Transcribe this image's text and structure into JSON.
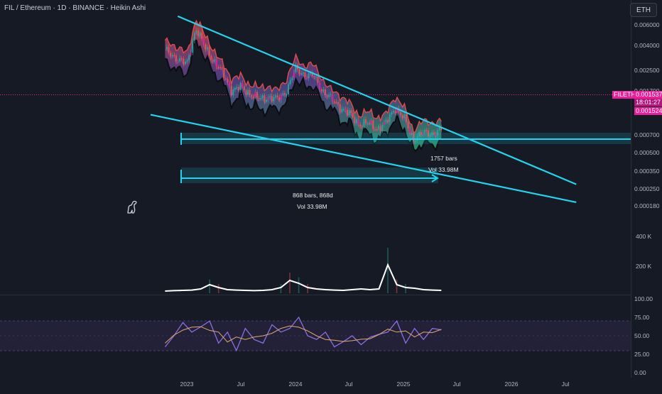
{
  "header": {
    "title": "FIL / Ethereum · 1D · BINANCE · Heikin Ashi",
    "currency_button": "ETH"
  },
  "price_badges": {
    "symbol": "FILETH",
    "last_price": "0.001537",
    "countdown": "18:01:27",
    "low_price": "0.001524"
  },
  "measure": {
    "long_bars": "1757 bars",
    "long_vol": "Vol 33.98M",
    "short_bars": "868 bars, 868d",
    "short_vol": "Vol 33.98M"
  },
  "colors": {
    "background": "#161a25",
    "trendline": "#22d3ee",
    "bull_candle": "#26a69a",
    "bear_candle": "#ef5350",
    "price_line": "#e91e98",
    "ribbon_red": "#e04b4b",
    "ribbon_green": "#2bb673",
    "ribbon_purple": "#7b57c7",
    "volume_line": "#ffffff",
    "rsi_line": "#8c6fe0",
    "rsi_signal": "#e6a86b",
    "measure_fill": "#22d3ee"
  },
  "chart_data": [
    {
      "type": "line",
      "name": "price",
      "scale": "log",
      "y_tick_labels": [
        "0.006000",
        "0.004000",
        "0.002500",
        "0.001700",
        "0.000700",
        "0.000500",
        "0.000350",
        "0.000250",
        "0.000180"
      ],
      "x_tick_labels": [
        "2023",
        "Jul",
        "2024",
        "Jul",
        "2025",
        "Jul",
        "2026",
        "Jul"
      ],
      "x": [
        "2022-10",
        "2022-11",
        "2022-12",
        "2023-01",
        "2023-02",
        "2023-03",
        "2023-04",
        "2023-05",
        "2023-06",
        "2023-07",
        "2023-08",
        "2023-09",
        "2023-10",
        "2023-11",
        "2023-12",
        "2024-01",
        "2024-02",
        "2024-03",
        "2024-04",
        "2024-05",
        "2024-06",
        "2024-07",
        "2024-08",
        "2024-09",
        "2024-10",
        "2024-11",
        "2024-12",
        "2025-01",
        "2025-02",
        "2025-03",
        "2025-04",
        "2025-05"
      ],
      "values": [
        0.0045,
        0.0042,
        0.0039,
        0.0036,
        0.0058,
        0.0045,
        0.0038,
        0.0032,
        0.0026,
        0.0027,
        0.0025,
        0.0023,
        0.0024,
        0.0023,
        0.0026,
        0.0034,
        0.0032,
        0.0031,
        0.0026,
        0.0023,
        0.0021,
        0.0019,
        0.0017,
        0.0017,
        0.0016,
        0.0017,
        0.0021,
        0.0018,
        0.0014,
        0.0015,
        0.0015,
        0.00155
      ],
      "trendlines": [
        {
          "name": "upper",
          "from": [
            "2022-12",
            0.0067
          ],
          "to": [
            "2026-08",
            0.00078
          ]
        },
        {
          "name": "lower",
          "from": [
            "2022-09",
            0.0019
          ],
          "to": [
            "2026-08",
            0.00062
          ]
        }
      ],
      "last_price": 0.001537
    },
    {
      "type": "line",
      "name": "volume",
      "y_tick_labels": [
        "400 K",
        "200 K"
      ],
      "values": [
        15,
        18,
        20,
        22,
        30,
        60,
        40,
        25,
        22,
        20,
        18,
        20,
        25,
        40,
        90,
        70,
        40,
        30,
        25,
        22,
        20,
        25,
        30,
        25,
        30,
        200,
        60,
        40,
        35,
        25,
        22,
        20
      ]
    },
    {
      "type": "line",
      "name": "rsi",
      "y_tick_labels": [
        "100.00",
        "75.00",
        "50.00",
        "25.00",
        "0.00"
      ],
      "ylim": [
        0,
        100
      ],
      "values": [
        35,
        50,
        68,
        55,
        62,
        70,
        40,
        55,
        30,
        60,
        45,
        40,
        65,
        55,
        60,
        75,
        50,
        45,
        55,
        35,
        42,
        50,
        38,
        48,
        52,
        55,
        70,
        40,
        60,
        45,
        60,
        58
      ]
    }
  ]
}
